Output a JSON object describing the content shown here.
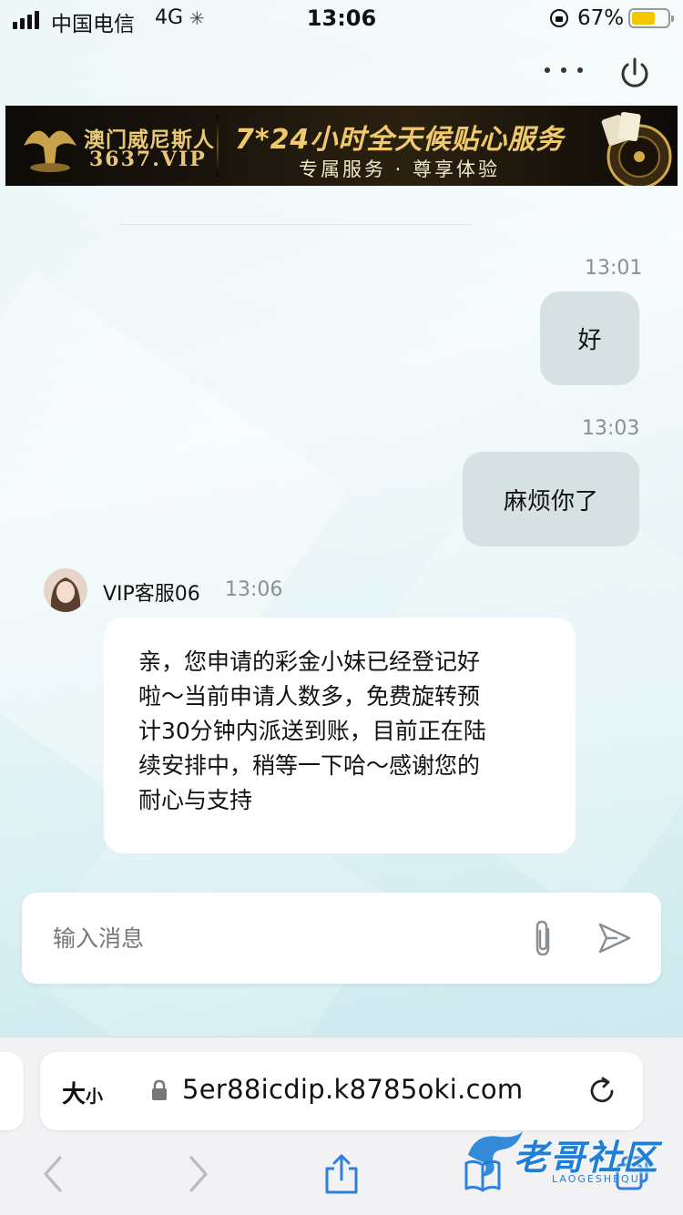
{
  "status_bar": {
    "carrier": "中国电信",
    "network": "4G",
    "time": "13:06",
    "battery_percent": "67%",
    "battery_level": 0.67
  },
  "banner": {
    "brand": "澳门威尼斯人",
    "code": "3637.VIP",
    "headline": "7*24小时全天候贴心服务",
    "subline": "专属服务 · 尊享体验"
  },
  "messages": {
    "outgoing": [
      {
        "time": "13:01",
        "text": "好"
      },
      {
        "time": "13:03",
        "text": "麻烦你了"
      }
    ],
    "incoming": {
      "sender": "VIP客服06",
      "time": "13:06",
      "lines": [
        "亲，您申请的彩金小妹已经登记好",
        "啦～当前申请人数多，免费旋转预",
        "计30分钟内派送到账，目前正在陆",
        "续安排中，稍等一下哈～感谢您的",
        "耐心与支持"
      ]
    }
  },
  "input": {
    "placeholder": "输入消息"
  },
  "browser": {
    "text_size_big": "大",
    "text_size_small": "小",
    "url": "5er88icdip.k8785oki.com"
  },
  "watermark": {
    "text": "老哥社区",
    "sub": "LAOGESHEQU"
  },
  "colors": {
    "accent": "#1f7fd6",
    "bubble_out": "#d6e1e3",
    "banner_gold": "#f0c96a"
  }
}
